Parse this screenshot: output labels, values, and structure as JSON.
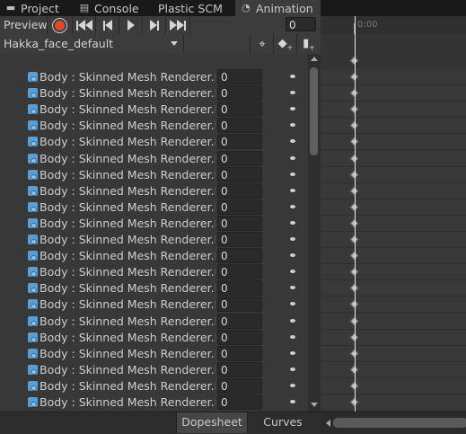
{
  "tabs": [
    {
      "label": "Project",
      "icon": "folder-icon"
    },
    {
      "label": "Console",
      "icon": "console-icon"
    },
    {
      "label": "Plastic SCM",
      "icon": ""
    },
    {
      "label": "Animation",
      "icon": "animation-clock-icon"
    }
  ],
  "toolbar": {
    "preview_label": "Preview",
    "frame_value": "0",
    "record_color": "#e04a28"
  },
  "timeline": {
    "time_label": "0:00"
  },
  "clip": {
    "selected": "Hakka_face_default"
  },
  "properties": {
    "rows": [
      {
        "name": "Body : Skinned Mesh Renderer.Blendshape",
        "value": "0"
      },
      {
        "name": "Body : Skinned Mesh Renderer.Blendshape",
        "value": "0"
      },
      {
        "name": "Body : Skinned Mesh Renderer.Blendshape",
        "value": "0"
      },
      {
        "name": "Body : Skinned Mesh Renderer.Blendshape",
        "value": "0"
      },
      {
        "name": "Body : Skinned Mesh Renderer.Blendshape",
        "value": "0"
      },
      {
        "name": "Body : Skinned Mesh Renderer.Blendshape",
        "value": "0"
      },
      {
        "name": "Body : Skinned Mesh Renderer.Blendshape",
        "value": "0"
      },
      {
        "name": "Body : Skinned Mesh Renderer.Blendshape",
        "value": "0"
      },
      {
        "name": "Body : Skinned Mesh Renderer.Blendshape",
        "value": "0"
      },
      {
        "name": "Body : Skinned Mesh Renderer.Blendshape",
        "value": "0"
      },
      {
        "name": "Body : Skinned Mesh Renderer.Blendshape",
        "value": "0"
      },
      {
        "name": "Body : Skinned Mesh Renderer.Blendshape",
        "value": "0"
      },
      {
        "name": "Body : Skinned Mesh Renderer.Blendshape",
        "value": "0"
      },
      {
        "name": "Body : Skinned Mesh Renderer.Blendshape",
        "value": "0"
      },
      {
        "name": "Body : Skinned Mesh Renderer.Blendshape",
        "value": "0"
      },
      {
        "name": "Body : Skinned Mesh Renderer.Blendshape",
        "value": "0"
      },
      {
        "name": "Body : Skinned Mesh Renderer.Blendshape",
        "value": "0"
      },
      {
        "name": "Body : Skinned Mesh Renderer.Blendshape",
        "value": "0"
      },
      {
        "name": "Body : Skinned Mesh Renderer.Blendshape",
        "value": "0"
      },
      {
        "name": "Body : Skinned Mesh Renderer.Blendshape",
        "value": "0"
      },
      {
        "name": "Body : Skinned Mesh Renderer.Blendshape",
        "value": "0"
      }
    ]
  },
  "bottom_tabs": {
    "dopesheet": "Dopesheet",
    "curves": "Curves"
  }
}
